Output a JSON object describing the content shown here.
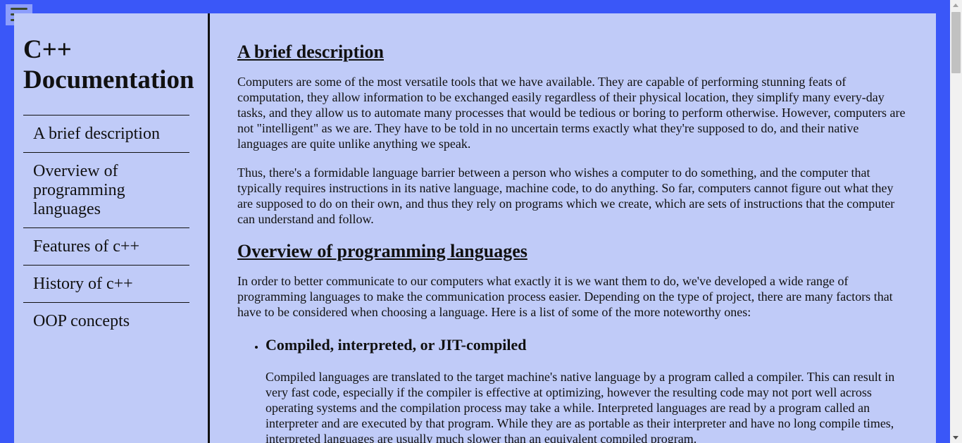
{
  "menu": {
    "icon": "hamburger-menu-icon"
  },
  "sidebar": {
    "title_line1": "C++",
    "title_line2": "Documentation",
    "items": [
      {
        "label": "A brief description"
      },
      {
        "label": "Overview of programming languages"
      },
      {
        "label": "Features of c++"
      },
      {
        "label": "History of c++"
      },
      {
        "label": "OOP concepts"
      }
    ]
  },
  "main": {
    "section1": {
      "heading": "A brief description",
      "p1": "Computers are some of the most versatile tools that we have available. They are capable of performing stunning feats of computation, they allow information to be exchanged easily regardless of their physical location, they simplify many every-day tasks, and they allow us to automate many processes that would be tedious or boring to perform otherwise. However, computers are not \"intelligent\" as we are. They have to be told in no uncertain terms exactly what they're supposed to do, and their native languages are quite unlike anything we speak.",
      "p2": "Thus, there's a formidable language barrier between a person who wishes a computer to do something, and the computer that typically requires instructions in its native language, machine code, to do anything. So far, computers cannot figure out what they are supposed to do on their own, and thus they rely on programs which we create, which are sets of instructions that the computer can understand and follow."
    },
    "section2": {
      "heading": "Overview of programming languages",
      "p1": "In order to better communicate to our computers what exactly it is we want them to do, we've developed a wide range of programming languages to make the communication process easier. Depending on the type of project, there are many factors that have to be considered when choosing a language. Here is a list of some of the more noteworthy ones:",
      "list_item_heading": "Compiled, interpreted, or JIT-compiled",
      "list_item_text": "Compiled languages are translated to the target machine's native language by a program called a compiler. This can result in very fast code, especially if the compiler is effective at optimizing, however the resulting code may not port well across operating systems and the compilation process may take a while. Interpreted languages are read by a program called an interpreter and are executed by that program. While they are as portable as their interpreter and have no long compile times, interpreted languages are usually much slower than an equivalent compiled program."
    }
  },
  "colors": {
    "outer_background": "#3a57f8",
    "page_background": "#c0cbf8",
    "text": "#111111"
  }
}
